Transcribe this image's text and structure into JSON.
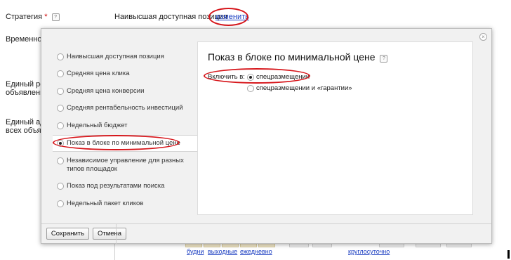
{
  "background": {
    "strategy_label": "Стратегия",
    "required_mark": "*",
    "help_glyph": "?",
    "strategy_value": "Наивысшая доступная позиция",
    "change_link": "изменить",
    "time_label": "Временной",
    "single_reg_line1": "Единый рег",
    "single_reg_line2": "объявлений",
    "single_addr_line1": "Единый адр",
    "single_addr_line2": "всех объяв",
    "bottom_links": {
      "weekdays": "будни",
      "weekends": "выходные",
      "daily": "ежедневно",
      "round_the_clock": "круглосуточно"
    }
  },
  "modal": {
    "close_glyph": "×",
    "options": [
      {
        "label": "Наивысшая доступная позиция",
        "selected": false
      },
      {
        "label": "Средняя цена клика",
        "selected": false
      },
      {
        "label": "Средняя цена конверсии",
        "selected": false
      },
      {
        "label": "Средняя рентабельность инвестиций",
        "selected": false
      },
      {
        "label": "Недельный бюджет",
        "selected": false
      },
      {
        "label": "Показ в блоке по минимальной цене",
        "selected": true
      },
      {
        "label": "Независимое управление для разных",
        "label2": "типов площадок",
        "selected": false
      },
      {
        "label": "Показ под результатами поиска",
        "selected": false
      },
      {
        "label": "Недельный пакет кликов",
        "selected": false
      }
    ],
    "panel": {
      "title": "Показ в блоке по минимальной цене",
      "help_glyph": "?",
      "include_label": "Включить в:",
      "placements": [
        {
          "label": "спецразмещении",
          "selected": true
        },
        {
          "label": "спецразмещении и «гарантии»",
          "selected": false
        }
      ]
    },
    "save_button": "Сохранить",
    "cancel_button": "Отмена"
  },
  "colors": {
    "highlight_ring": "#d6151a",
    "link": "#1a3dc1"
  }
}
